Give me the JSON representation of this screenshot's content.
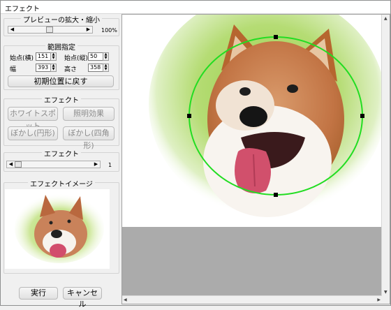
{
  "window": {
    "title": "エフェクト"
  },
  "preview_zoom": {
    "legend": "プレビューの拡大・縮小",
    "value": "100%",
    "slider_fraction": 0.5
  },
  "range": {
    "legend": "範囲指定",
    "start_x_label": "始点(横)",
    "start_x_value": "151",
    "start_y_label": "始点(縦)",
    "start_y_value": "50",
    "width_label": "幅",
    "width_value": "393",
    "height_label": "高さ",
    "height_value": "358",
    "reset_button": "初期位置に戻す"
  },
  "effect": {
    "legend": "エフェクト",
    "whitespot": "ホワイトスポット",
    "lighting": "照明効果",
    "blur_circle": "ぼかし(円形)",
    "blur_rect": "ぼかし(四角形)"
  },
  "effect_level": {
    "legend": "エフェクト",
    "value": "1",
    "slider_fraction": 0.0
  },
  "effect_image": {
    "legend": "エフェクトイメージ"
  },
  "footer": {
    "run": "実行",
    "cancel": "キャンセル"
  },
  "colors": {
    "ellipse": "#22dd22",
    "glow": "#a6d85a",
    "canvas_bg": "#ababab"
  },
  "icons": [
    "arrow-left-icon",
    "arrow-right-icon",
    "spin-up-icon",
    "spin-down-icon",
    "arrow-up-icon",
    "arrow-down-icon"
  ]
}
